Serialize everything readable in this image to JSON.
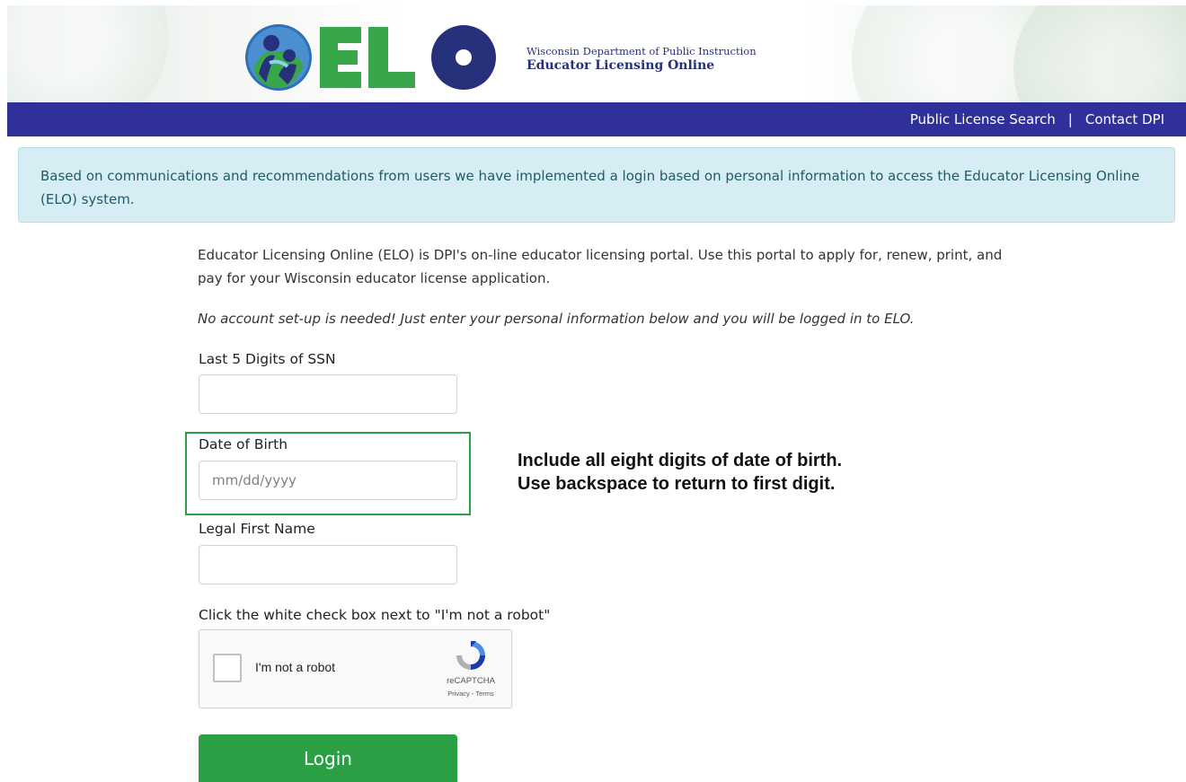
{
  "header": {
    "logo_text": "ELO",
    "department": "Wisconsin Department of Public Instruction",
    "portal_name": "Educator Licensing Online"
  },
  "nav": {
    "public_license_search": "Public License Search",
    "separator": "|",
    "contact": "Contact DPI"
  },
  "alert": {
    "text": "Based on communications and recommendations from users we have implemented a login based on personal information to access the Educator Licensing Online (ELO) system."
  },
  "intro": "Educator Licensing Online (ELO) is DPI's on-line educator licensing portal. Use this portal to apply for, renew, print, and pay for your Wisconsin educator license application.",
  "note": "No account set-up is needed! Just enter your personal information below and you will be logged in to ELO.",
  "form": {
    "ssn_label": "Last 5 Digits of SSN",
    "ssn_value": "",
    "dob_label": "Date of Birth",
    "dob_placeholder": "mm/dd/yyyy",
    "dob_hint_line1": "Include all eight digits of date of birth.",
    "dob_hint_line2": "Use backspace to return to first digit.",
    "first_name_label": "Legal First Name",
    "first_name_value": "",
    "captcha_instruction": "Click the white check box next to \"I'm not a robot\"",
    "login_label": "Login"
  },
  "recaptcha": {
    "label": "I'm not a robot",
    "brand": "reCAPTCHA",
    "links": "Privacy - Terms"
  },
  "colors": {
    "nav_bar": "#30309a",
    "alert_bg": "#d6eef3",
    "highlight": "#2c9f4b",
    "login_button": "#2a9f43",
    "logo_green": "#3aa64b",
    "logo_navy": "#27307a"
  }
}
